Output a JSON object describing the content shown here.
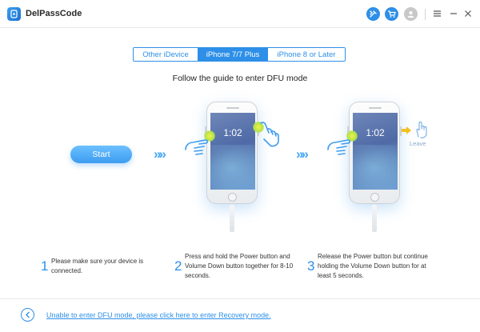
{
  "app": {
    "title": "DelPassCode",
    "accent": "#2d8fe8"
  },
  "titlebar": {
    "icons": [
      "tools-icon",
      "cart-icon",
      "user-icon",
      "menu-icon",
      "minimize-icon",
      "close-icon"
    ]
  },
  "tabs": [
    {
      "label": "Other iDevice",
      "active": false
    },
    {
      "label": "iPhone 7/7 Plus",
      "active": true
    },
    {
      "label": "iPhone 8 or Later",
      "active": false
    }
  ],
  "guide_title": "Follow the guide to enter DFU mode",
  "start_label": "Start",
  "phones": [
    {
      "time": "1:02"
    },
    {
      "time": "1:02",
      "action_label": "Leave"
    }
  ],
  "steps": [
    {
      "number": "1",
      "lines": [
        "Please make sure your device is",
        "connected."
      ]
    },
    {
      "number": "2",
      "lines": [
        "Press and hold the Power button and",
        "Volume Down button together for 8-10",
        "seconds."
      ]
    },
    {
      "number": "3",
      "lines": [
        "Release the Power button but continue",
        "holding the Volume Down button for at",
        "least 5 seconds."
      ]
    }
  ],
  "footer": {
    "link_text": "Unable to enter DFU mode, please click here to enter Recovery mode."
  }
}
